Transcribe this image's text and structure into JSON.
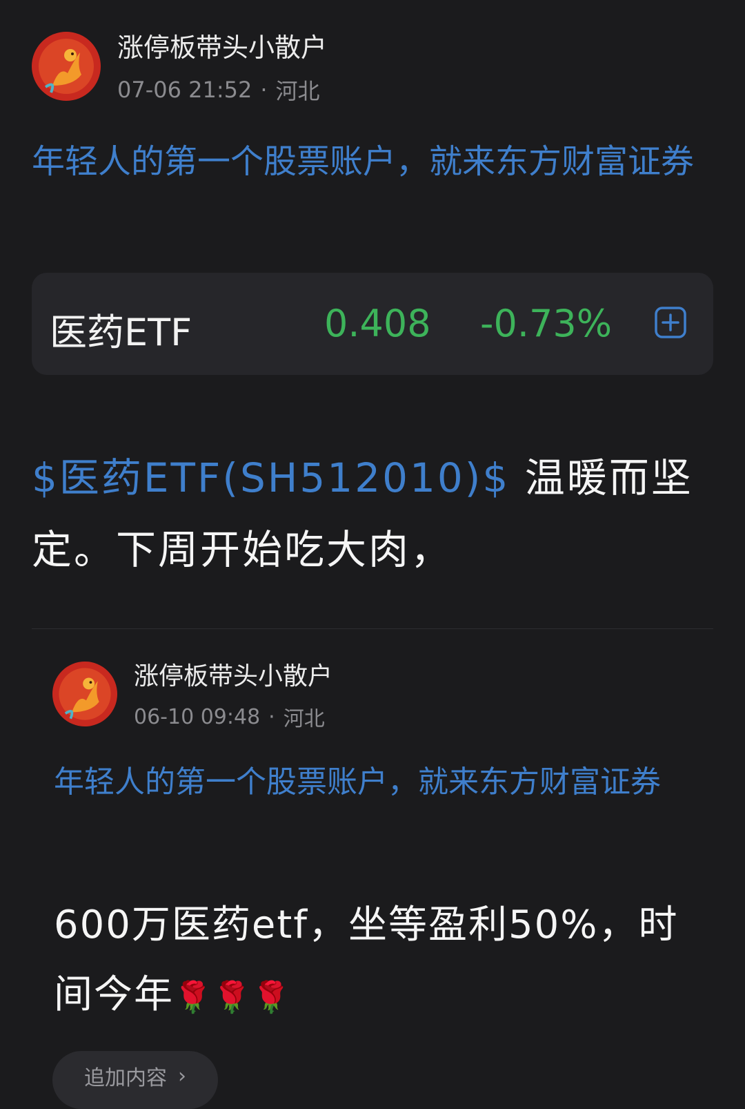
{
  "post": {
    "author": "涨停板带头小散户",
    "time": "07-06 21:52",
    "location": "河北",
    "promo": "年轻人的第一个股票账户，就来东方财富证券",
    "stock_card": {
      "name": "医药ETF",
      "price": "0.408",
      "change": "-0.73%"
    },
    "stock_link": "$医药ETF(SH512010)$",
    "text": " 温暖而坚定。下周开始吃大肉，"
  },
  "quoted_post": {
    "author": "涨停板带头小散户",
    "time": "06-10 09:48",
    "location": "河北",
    "promo": "年轻人的第一个股票账户，就来东方财富证券",
    "text": "600万医药etf，坐等盈利50%，时间今年",
    "emoji": "🌹",
    "append_label": "追加内容"
  },
  "colors": {
    "background": "#1b1b1d",
    "link_blue": "#3f7fcc",
    "down_green": "#3db35a",
    "card_bg": "#26262a"
  }
}
